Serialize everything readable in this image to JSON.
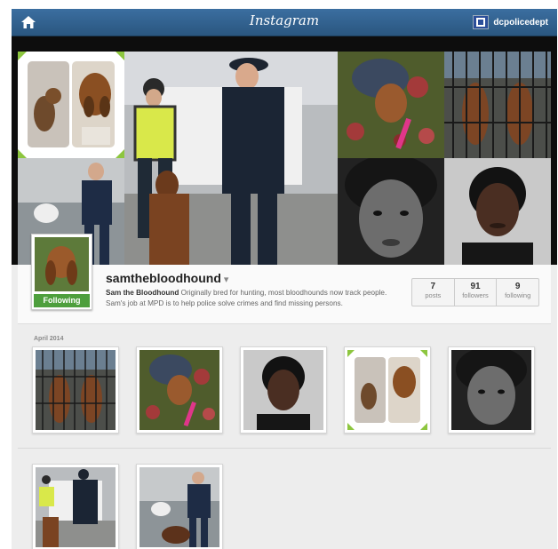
{
  "nav": {
    "title": "Instagram",
    "username": "dcpolicedept",
    "home_icon": "home-icon"
  },
  "profile": {
    "username": "samthebloodhound",
    "caret": "▾",
    "follow_label": "Following",
    "bio_name": "Sam the Bloodhound",
    "bio_text": " Originally bred for hunting, most bloodhounds now track people. Sam's job at MPD is to help police solve crimes and find missing persons.",
    "stats": [
      {
        "value": "7",
        "label": "posts"
      },
      {
        "value": "91",
        "label": "followers"
      },
      {
        "value": "9",
        "label": "following"
      }
    ]
  },
  "feed": {
    "month": "April 2014"
  },
  "colors": {
    "nav": "#2f5f8c",
    "follow": "#4e9f3d",
    "accent_green": "#8dc63f"
  }
}
